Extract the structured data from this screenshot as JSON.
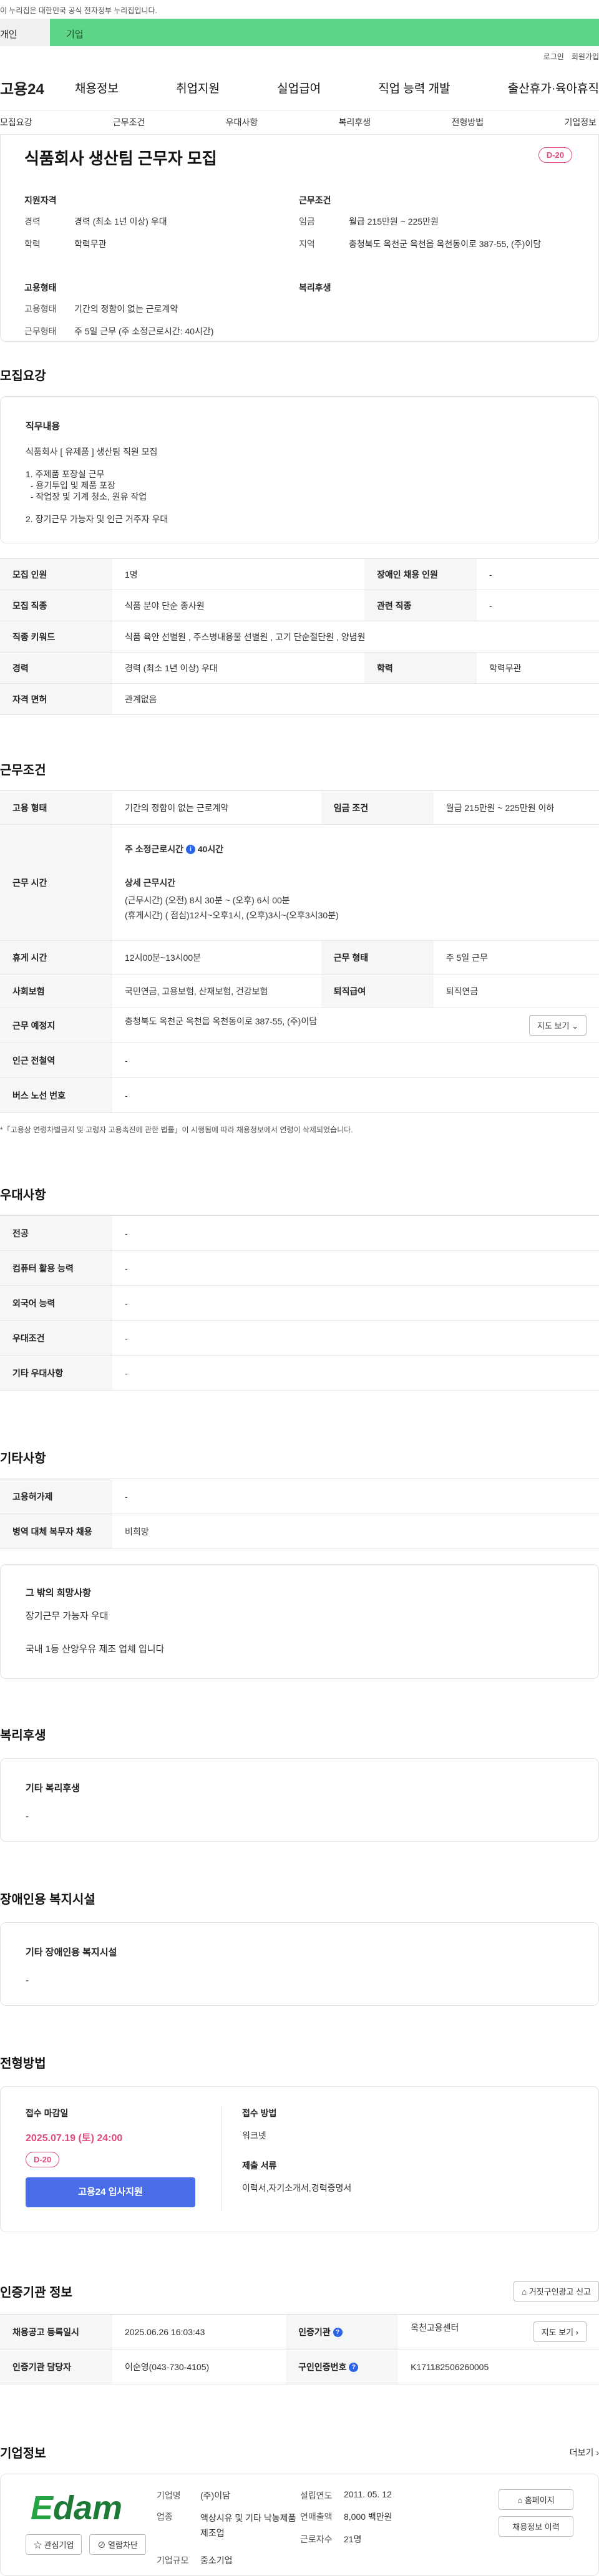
{
  "gov_banner": "이 누리집은 대한민국 공식 전자정부 누리집입니다.",
  "audience_tabs": [
    "개인",
    "기업"
  ],
  "util_links": [
    "로그인",
    "회원가입"
  ],
  "logo": "고용24",
  "gnb": [
    "채용정보",
    "취업지원",
    "실업급여",
    "직업 능력 개발",
    "출산휴가·육아휴직"
  ],
  "lnb": [
    "모집요강",
    "근무조건",
    "우대사항",
    "복리후생",
    "전형방법",
    "기업정보"
  ],
  "hero": {
    "title": "식품회사 생산팀 근무자 모집",
    "dday": "D-20",
    "groups": [
      {
        "title": "지원자격",
        "rows": [
          {
            "k": "경력",
            "v": "경력 (최소 1년 이상) 우대"
          },
          {
            "k": "학력",
            "v": "학력무관"
          }
        ]
      },
      {
        "title": "근무조건",
        "rows": [
          {
            "k": "임금",
            "v": "월급 215만원 ~ 225만원"
          },
          {
            "k": "지역",
            "v": "충청북도 옥천군 옥천읍 옥천동이로 387-55, (주)이담"
          }
        ]
      },
      {
        "title": "고용형태",
        "rows": [
          {
            "k": "고용형태",
            "v": "기간의 정함이 없는 근로계약"
          },
          {
            "k": "근무형태",
            "v": "주 5일 근무 (주 소정근로시간: 40시간)"
          }
        ]
      },
      {
        "title": "복리후생",
        "rows": []
      }
    ]
  },
  "recruit": {
    "title": "모집요강",
    "duty_title": "직무내용",
    "duty_lines": [
      "식품회사 [ 유제품 ] 생산팀 직원 모집",
      "",
      "1. 주제품 포장실 근무",
      "  - 용기투입 및 제품 포장",
      "  - 작업장 및 기계 청소, 원유 작업",
      "",
      "2. 장기근무 가능자 및 인근 거주자 우대"
    ],
    "table": [
      [
        "모집 인원",
        "1명",
        "장애인 채용 인원",
        "-"
      ],
      [
        "모집 직종",
        "식품 분야 단순 종사원",
        "관련 직종",
        "-"
      ],
      [
        "직종 키워드",
        "식품 육안 선별원 , 주스병내용물 선별원 , 고기 단순절단원 , 양념원"
      ],
      [
        "경력",
        "경력 (최소 1년 이상) 우대",
        "학력",
        "학력무관"
      ],
      [
        "자격 면허",
        "관계없음"
      ]
    ]
  },
  "conditions": {
    "title": "근무조건",
    "employment_type_label": "고용 형태",
    "employment_type": "기간의 정함이 없는 근로계약",
    "wage_label": "임금 조건",
    "wage": "월급 215만원 ~ 225만원 이하",
    "work_time_label": "근무 시간",
    "weekly_hours_prefix": "주 소정근로시간",
    "weekly_hours": "40시간",
    "detail_title": "상세 근무시간",
    "detail_lines": [
      "(근무시간) (오전) 8시 30분 ~ (오후) 6시 00분",
      "(휴게시간) ( 점심)12시~오후1시, (오후)3시~(오후3시30분)"
    ],
    "rows": [
      [
        "휴게 시간",
        "12시00분~13시00분",
        "근무 형태",
        "주 5일 근무"
      ],
      [
        "사회보험",
        "국민연금, 고용보험, 산재보험, 건강보험",
        "퇴직급여",
        "퇴직연금"
      ]
    ],
    "location_label": "근무 예정지",
    "location": "충청북도 옥천군 옥천읍 옥천동이로 387-55, (주)이담",
    "map_btn": "지도 보기",
    "station_label": "인근 전철역",
    "station": "-",
    "bus_label": "버스 노선 번호",
    "bus": "-",
    "note": "*「고용상 연령차별금지 및 고령자 고용촉진에 관한 법률」이 시행됨에 따라 채용정보에서 연령이 삭제되었습니다."
  },
  "prefer": {
    "title": "우대사항",
    "rows": [
      [
        "전공",
        "-"
      ],
      [
        "컴퓨터 활용 능력",
        "-"
      ],
      [
        "외국어 능력",
        "-"
      ],
      [
        "우대조건",
        "-"
      ],
      [
        "기타 우대사항",
        "-"
      ]
    ]
  },
  "etc": {
    "title": "기타사항",
    "rows": [
      [
        "고용허가제",
        "-"
      ],
      [
        "병역 대체 복무자 채용",
        "비희망"
      ]
    ],
    "box_title": "그 밖의 희망사항",
    "box_lines": [
      "장기근무 가능자 우대",
      "",
      "국내 1등 산양우유 제조 업체 입니다"
    ]
  },
  "welfare": {
    "title": "복리후생",
    "box_title": "기타 복리후생",
    "box_value": "-"
  },
  "disabled": {
    "title": "장애인용 복지시설",
    "box_title": "기타 장애인용 복지시설",
    "box_value": "-"
  },
  "selection": {
    "title": "전형방법",
    "deadline_label": "접수 마감일",
    "deadline": "2025.07.19 (토) 24:00",
    "dday": "D-20",
    "apply_btn": "고용24 입사지원",
    "method_label": "접수 방법",
    "method": "워크넷",
    "docs_label": "제출 서류",
    "docs": "이력서,자기소개서,경력증명서"
  },
  "agency": {
    "title": "인증기관 정보",
    "report_btn": "거짓구인광고 신고",
    "reg_date_label": "채용공고 등록일시",
    "reg_date": "2025.06.26 16:03:43",
    "agency_label": "인증기관",
    "agency": "옥천고용센터",
    "map_btn": "지도 보기",
    "manager_label": "인증기관 담당자",
    "manager": "이순영(043-730-4105)",
    "cert_label": "구인인증번호",
    "cert": "K171182506260005"
  },
  "company": {
    "title": "기업정보",
    "more": "더보기",
    "logo_text": "dam",
    "logo_e": "E",
    "fav_btn": "관심기업",
    "block_btn": "열람차단",
    "fields": {
      "name_label": "기업명",
      "name": "(주)이담",
      "founded_label": "설립연도",
      "founded": "2011. 05. 12",
      "industry_label": "업종",
      "industry": "액상시유 및 기타 낙농제품 제조업",
      "sales_label": "연매출액",
      "sales": "8,000 백만원",
      "employees_label": "근로자수",
      "employees": "21명",
      "size_label": "기업규모",
      "size": "중소기업"
    },
    "homepage_btn": "홈페이지",
    "jobs_btn": "채용정보 이력"
  },
  "colors": {
    "green": "#5dd487",
    "pink": "#e04b7b",
    "blue": "#4a6ee8"
  }
}
